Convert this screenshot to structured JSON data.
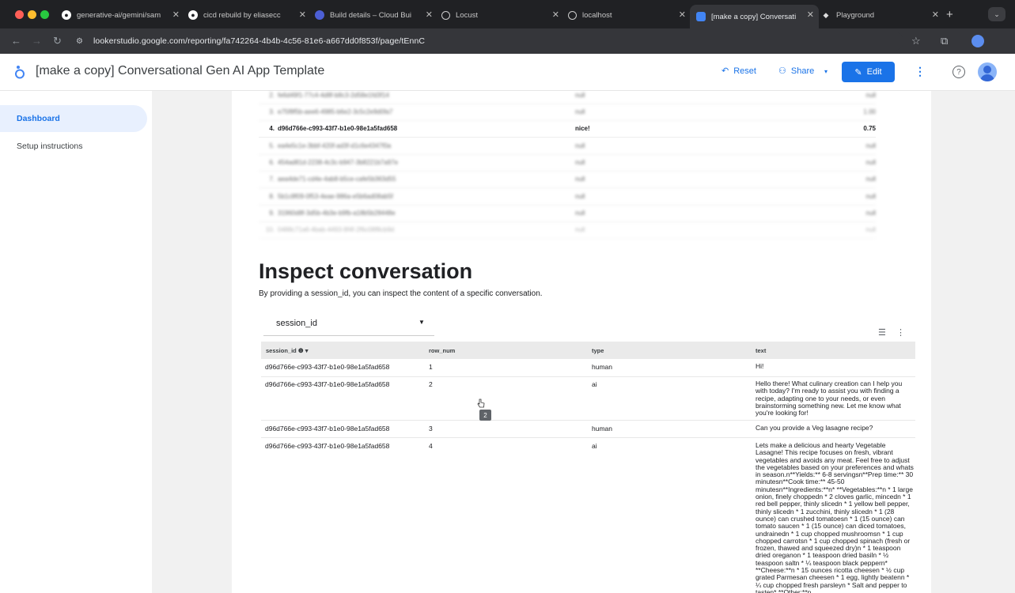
{
  "browser": {
    "tabs": [
      {
        "label": "generative-ai/gemini/sam",
        "icon": "github-icon"
      },
      {
        "label": "cicd rebuild by eliasecc",
        "icon": "github-icon"
      },
      {
        "label": "Build details – Cloud Bui",
        "icon": "cloud-build-icon"
      },
      {
        "label": "Locust",
        "icon": "globe-icon"
      },
      {
        "label": "localhost",
        "icon": "globe-icon"
      },
      {
        "label": "[make a copy] Conversati",
        "icon": "looker-icon"
      },
      {
        "label": "Playground",
        "icon": "playground-icon"
      }
    ],
    "url": "lookerstudio.google.com/reporting/fa742264-4b4b-4c56-81e6-a667dd0f853f/page/tEnnC"
  },
  "app": {
    "title": "[make a copy] Conversational Gen AI App Template",
    "reset_label": "Reset",
    "share_label": "Share",
    "edit_label": "Edit"
  },
  "sidebar": {
    "items": [
      {
        "label": "Dashboard",
        "active": true
      },
      {
        "label": "Setup instructions",
        "active": false
      }
    ]
  },
  "top_table": {
    "rows": [
      {
        "num": "2.",
        "id": "fe6d49f1-77c4-4d8f-b8c3-2d58e1fd3f14",
        "col3": "null",
        "col4": "null",
        "blurred": true
      },
      {
        "num": "3.",
        "id": "e75f8f5b-aee6-4985-b6e2-3c5c2e9d0fa7",
        "col3": "null",
        "col4": "1.00",
        "blurred": true
      },
      {
        "num": "4.",
        "id": "d96d766e-c993-43f7-b1e0-98e1a5fad658",
        "col3": "nice!",
        "col4": "0.75",
        "blurred": false
      },
      {
        "num": "5.",
        "id": "ea4e5c1e-3bbf-420f-ad3f-d1c6e4347f0a",
        "col3": "null",
        "col4": "null",
        "blurred": true
      },
      {
        "num": "6.",
        "id": "454ad81d-2238-4c3c-b947-3b8221b7a97e",
        "col3": "null",
        "col4": "null",
        "blurred": true
      },
      {
        "num": "7.",
        "id": "aea4de71-cd4e-4ab8-b5ce-cafe5b363d55",
        "col3": "null",
        "col4": "null",
        "blurred": true
      },
      {
        "num": "8.",
        "id": "5b1c8f09-0f53-4eae-986a-e5b6ad08ab5f",
        "col3": "null",
        "col4": "null",
        "blurred": true
      },
      {
        "num": "9.",
        "id": "31960d8f-3d5b-4b3e-b9fb-a18b5b28448e",
        "col3": "null",
        "col4": "null",
        "blurred": true
      },
      {
        "num": "10.",
        "id": "0488c71a6-4bab-4493-9f4f-2f6c08f8cb9d",
        "col3": "null",
        "col4": "null",
        "blurred": true
      }
    ]
  },
  "inspect": {
    "heading": "Inspect conversation",
    "description": "By providing a session_id, you can inspect the content of a specific conversation.",
    "filter_label": "session_id"
  },
  "conv_table": {
    "headers": [
      "session_id",
      "row_num",
      "type",
      "text"
    ],
    "rows": [
      {
        "session_id": "d96d766e-c993-43f7-b1e0-98e1a5fad658",
        "row_num": "1",
        "type": "human",
        "text": "Hi!"
      },
      {
        "session_id": "d96d766e-c993-43f7-b1e0-98e1a5fad658",
        "row_num": "2",
        "type": "ai",
        "text": "Hello there! What culinary creation can I help you with today? I'm ready to assist you with finding a recipe, adapting one to your needs, or even brainstorming something new. Let me know what you're looking for!"
      },
      {
        "session_id": "d96d766e-c993-43f7-b1e0-98e1a5fad658",
        "row_num": "3",
        "type": "human",
        "text": "Can you provide a Veg lasagne recipe?"
      },
      {
        "session_id": "d96d766e-c993-43f7-b1e0-98e1a5fad658",
        "row_num": "4",
        "type": "ai",
        "text": "Lets make a delicious and hearty Vegetable Lasagne! This recipe focuses on fresh, vibrant vegetables and avoids any meat. Feel free to adjust the vegetables based on your preferences and whats in season.n**Yields:** 6-8 servingsn**Prep time:** 30 minutesn**Cook time:** 45-50 minutesn**Ingredients:**n* **Vegetables:**n * 1 large onion, finely choppedn * 2 cloves garlic, mincedn * 1 red bell pepper, thinly slicedn * 1 yellow bell pepper, thinly slicedn * 1 zucchini, thinly slicedn * 1 (28 ounce) can crushed tomatoesn * 1 (15 ounce) can tomato saucen * 1 (15 ounce) can diced tomatoes, undrainedn * 1 cup chopped mushroomsn * 1 cup chopped carrotsn * 1 cup chopped spinach (fresh or frozen, thawed and squeezed dry)n * 1 teaspoon dried oreganon * 1 teaspoon dried basiln * ½ teaspoon saltn * ¼ teaspoon black peppern* **Cheese:**n * 15 ounces ricotta cheesen * ½ cup grated Parmesan cheesen * 1 egg, lightly beatenn * ¼ cup chopped fresh parsleyn * Salt and pepper to tasten* **Other:**n"
      }
    ],
    "tooltip": "2"
  }
}
